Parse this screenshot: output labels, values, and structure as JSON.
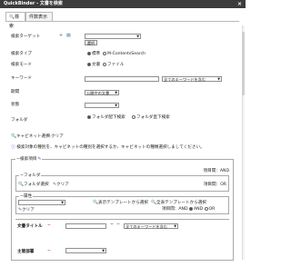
{
  "window": {
    "title": "QuickBinder - 文書を検索",
    "close": "×"
  },
  "tabs": [
    {
      "label": "検索"
    },
    {
      "label": "件数表示"
    }
  ],
  "form": {
    "search_target": {
      "label": "検索ターゲット",
      "select_value": "",
      "select_button": "選択"
    },
    "search_type": {
      "label": "検索タイプ",
      "options": [
        {
          "label": "標準",
          "selected": true
        },
        {
          "label": "M-ContentsSearch",
          "selected": false
        }
      ]
    },
    "search_mode": {
      "label": "検索モード",
      "options": [
        {
          "label": "文書",
          "selected": true
        },
        {
          "label": "ファイル",
          "selected": false
        }
      ]
    },
    "keyword": {
      "label": "キーワード",
      "value": "",
      "condition": "全てのキーワードを含む"
    },
    "period": {
      "label": "期間",
      "value": "公開中の文書"
    },
    "status": {
      "label": "状態",
      "value": ""
    },
    "folder": {
      "label": "フォルダ",
      "options": [
        {
          "label": "フォルダ配下検索",
          "selected": true
        },
        {
          "label": "フォルダ直下検索",
          "selected": false
        }
      ]
    },
    "cabinet_actions": {
      "select": "キャビネット選択",
      "clear": "クリア"
    },
    "note": "検索対象の種別を、キャビネットの種別を選択するか、キャビネットの種類選択しましてください。",
    "section_label": "検索項目",
    "condition_and": "項目間：AND",
    "condition_or": "項目間：OR",
    "folder_group": {
      "legend": "フォルダ",
      "select": "フォルダ選択",
      "clear": "クリア"
    },
    "attr_group": {
      "legend": "属性",
      "show_template": "表示テンプレートから選択",
      "all_template": "全表テンプレートから選択",
      "clear": "クリア",
      "condition": "項目間：AND",
      "or": "OR"
    },
    "doc_title": {
      "label": "文書タイトル",
      "condition": "全てのキーワードを含む"
    },
    "department": {
      "label": "主管部署"
    }
  },
  "colors": {
    "titlebar": "#3c3c3c",
    "required": "#d23b3b",
    "accent": "#2e63a7"
  }
}
